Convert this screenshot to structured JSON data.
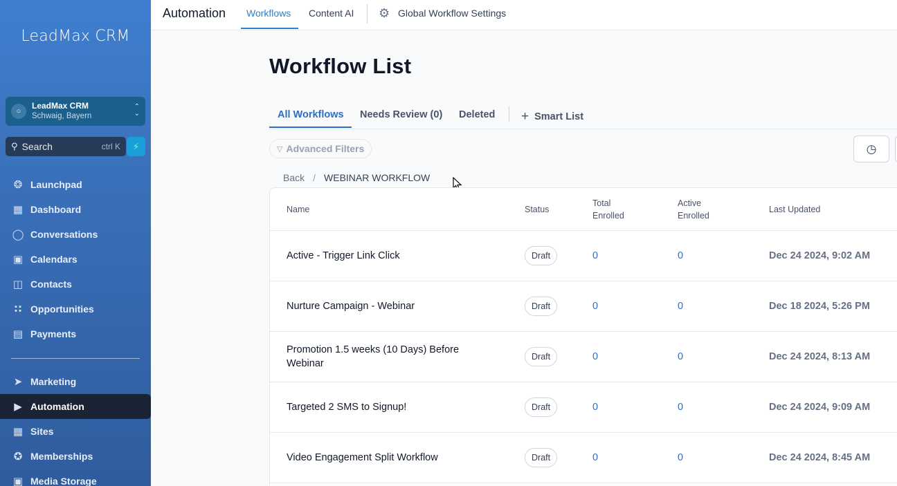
{
  "sidebar": {
    "brand": "LeadMax CRM",
    "account": {
      "name": "LeadMax CRM",
      "location": "Schwaig, Bayern"
    },
    "search": {
      "placeholder": "Search",
      "shortcut": "ctrl K"
    },
    "items": [
      {
        "label": "Launchpad",
        "icon": "rocket-icon"
      },
      {
        "label": "Dashboard",
        "icon": "grid-icon"
      },
      {
        "label": "Conversations",
        "icon": "chat-bubble-icon"
      },
      {
        "label": "Calendars",
        "icon": "calendar-icon"
      },
      {
        "label": "Contacts",
        "icon": "contact-book-icon"
      },
      {
        "label": "Opportunities",
        "icon": "nodes-icon"
      },
      {
        "label": "Payments",
        "icon": "receipt-icon"
      }
    ],
    "items2": [
      {
        "label": "Marketing",
        "icon": "send-icon"
      },
      {
        "label": "Automation",
        "icon": "automation-icon",
        "active": true
      },
      {
        "label": "Sites",
        "icon": "globe-icon"
      },
      {
        "label": "Memberships",
        "icon": "badge-icon"
      },
      {
        "label": "Media Storage",
        "icon": "image-icon"
      }
    ]
  },
  "topbar": {
    "title": "Automation",
    "tabs": [
      "Workflows",
      "Content AI"
    ],
    "settings_label": "Global Workflow Settings"
  },
  "main": {
    "title": "Workflow List",
    "tabs": [
      "All Workflows",
      "Needs Review (0)",
      "Deleted"
    ],
    "smart_list_label": "Smart List",
    "advanced_filters_label": "Advanced Filters",
    "breadcrumb": {
      "back": "Back",
      "separator": "/",
      "current": "WEBINAR WORKFLOW"
    }
  },
  "table": {
    "headers": {
      "name": "Name",
      "status": "Status",
      "total_enrolled": [
        "Total",
        "Enrolled"
      ],
      "active_enrolled": [
        "Active",
        "Enrolled"
      ],
      "last_updated": "Last Updated"
    },
    "rows": [
      {
        "name": "Active - Trigger Link Click",
        "status": "Draft",
        "total": "0",
        "active": "0",
        "updated": "Dec 24 2024, 9:02 AM"
      },
      {
        "name": "Nurture Campaign - Webinar",
        "status": "Draft",
        "total": "0",
        "active": "0",
        "updated": "Dec 18 2024, 5:26 PM"
      },
      {
        "name": "Promotion 1.5 weeks (10 Days) Before Webinar",
        "status": "Draft",
        "total": "0",
        "active": "0",
        "updated": "Dec 24 2024, 8:13 AM"
      },
      {
        "name": "Targeted 2 SMS to Signup!",
        "status": "Draft",
        "total": "0",
        "active": "0",
        "updated": "Dec 24 2024, 9:09 AM"
      },
      {
        "name": "Video Engagement Split Workflow",
        "status": "Draft",
        "total": "0",
        "active": "0",
        "updated": "Dec 24 2024, 8:45 AM"
      }
    ]
  }
}
